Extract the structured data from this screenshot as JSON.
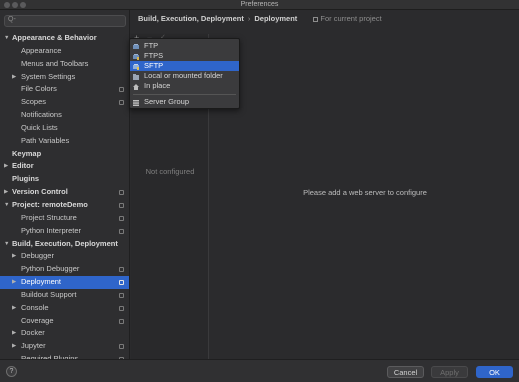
{
  "window": {
    "title": "Preferences"
  },
  "search": {
    "glyph": "Q-"
  },
  "tree": [
    {
      "label": "Appearance & Behavior",
      "level": 0,
      "expander": "open",
      "bold": true,
      "cfg": false
    },
    {
      "label": "Appearance",
      "level": 1,
      "expander": "none",
      "bold": false,
      "cfg": false
    },
    {
      "label": "Menus and Toolbars",
      "level": 1,
      "expander": "none",
      "bold": false,
      "cfg": false
    },
    {
      "label": "System Settings",
      "level": 1,
      "expander": "closed",
      "bold": false,
      "cfg": false
    },
    {
      "label": "File Colors",
      "level": 1,
      "expander": "none",
      "bold": false,
      "cfg": true
    },
    {
      "label": "Scopes",
      "level": 1,
      "expander": "none",
      "bold": false,
      "cfg": true
    },
    {
      "label": "Notifications",
      "level": 1,
      "expander": "none",
      "bold": false,
      "cfg": false
    },
    {
      "label": "Quick Lists",
      "level": 1,
      "expander": "none",
      "bold": false,
      "cfg": false
    },
    {
      "label": "Path Variables",
      "level": 1,
      "expander": "none",
      "bold": false,
      "cfg": false
    },
    {
      "label": "Keymap",
      "level": 0,
      "expander": "none",
      "bold": true,
      "cfg": false
    },
    {
      "label": "Editor",
      "level": 0,
      "expander": "closed",
      "bold": true,
      "cfg": false
    },
    {
      "label": "Plugins",
      "level": 0,
      "expander": "none",
      "bold": true,
      "cfg": false
    },
    {
      "label": "Version Control",
      "level": 0,
      "expander": "closed",
      "bold": true,
      "cfg": true
    },
    {
      "label": "Project: remoteDemo",
      "level": 0,
      "expander": "open",
      "bold": true,
      "cfg": true
    },
    {
      "label": "Project Structure",
      "level": 1,
      "expander": "none",
      "bold": false,
      "cfg": true
    },
    {
      "label": "Python Interpreter",
      "level": 1,
      "expander": "none",
      "bold": false,
      "cfg": true
    },
    {
      "label": "Build, Execution, Deployment",
      "level": 0,
      "expander": "open",
      "bold": true,
      "cfg": false
    },
    {
      "label": "Debugger",
      "level": 1,
      "expander": "closed",
      "bold": false,
      "cfg": false
    },
    {
      "label": "Python Debugger",
      "level": 1,
      "expander": "none",
      "bold": false,
      "cfg": true
    },
    {
      "label": "Deployment",
      "level": 1,
      "expander": "closed",
      "bold": false,
      "cfg": true,
      "selected": true
    },
    {
      "label": "Buildout Support",
      "level": 1,
      "expander": "none",
      "bold": false,
      "cfg": true
    },
    {
      "label": "Console",
      "level": 1,
      "expander": "closed",
      "bold": false,
      "cfg": true
    },
    {
      "label": "Coverage",
      "level": 1,
      "expander": "none",
      "bold": false,
      "cfg": true
    },
    {
      "label": "Docker",
      "level": 1,
      "expander": "closed",
      "bold": false,
      "cfg": false
    },
    {
      "label": "Jupyter",
      "level": 1,
      "expander": "closed",
      "bold": false,
      "cfg": true
    },
    {
      "label": "Required Plugins",
      "level": 1,
      "expander": "none",
      "bold": false,
      "cfg": true
    }
  ],
  "breadcrumb": {
    "section": "Build, Execution, Deployment",
    "separator": "›",
    "page": "Deployment",
    "scope": "For current project"
  },
  "toolbar": {
    "add": "+",
    "remove": "−",
    "apply": "✓"
  },
  "add_menu": {
    "items": [
      {
        "label": "FTP",
        "icon": "ftp-icon",
        "selected": false
      },
      {
        "label": "FTPS",
        "icon": "ftps-icon",
        "selected": false
      },
      {
        "label": "SFTP",
        "icon": "sftp-icon",
        "selected": true
      },
      {
        "label": "Local or mounted folder",
        "icon": "folder-icon",
        "selected": false
      },
      {
        "label": "In place",
        "icon": "home-icon",
        "selected": false
      }
    ],
    "group_item": {
      "label": "Server Group",
      "icon": "server-group-icon"
    }
  },
  "servers_panel": {
    "empty_text": "Not configured"
  },
  "details_panel": {
    "message": "Please add a web server to configure"
  },
  "footer": {
    "help": "?",
    "cancel": "Cancel",
    "apply": "Apply",
    "ok": "OK"
  },
  "colors": {
    "accent": "#2f65ca",
    "background": "#2b2b2d",
    "sidebar": "#2e2e30"
  }
}
